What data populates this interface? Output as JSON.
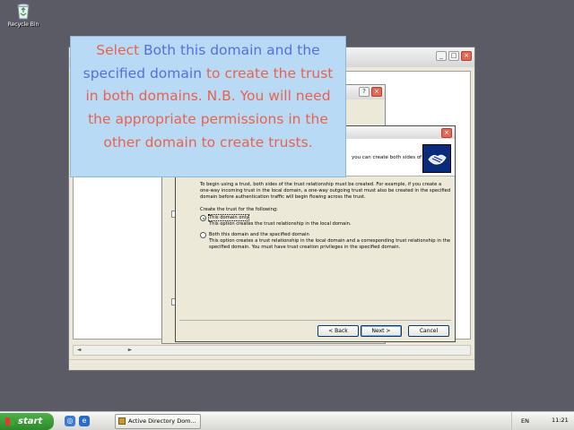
{
  "desktop": {
    "recycle_bin_label": "Recycle Bin"
  },
  "callout": {
    "part1": "Select ",
    "highlight1": "Both this domain and the specified domain",
    "part2": " to create the trust in both domains. N.B. You will need the appropriate permissions in the other domain to create trusts."
  },
  "wizard": {
    "header_text": "you can create both sides of",
    "intro": "To begin using a trust, both sides of the trust relationship must be created. For example, if you create a one-way incoming trust in the local domain, a one-way outgoing trust must also be created in the specified domain before authentication traffic will begin flowing across the trust.",
    "create_for_label": "Create the trust for the following:",
    "options": [
      {
        "label": "This domain only",
        "description": "This option creates the trust relationship in the local domain.",
        "selected": true
      },
      {
        "label": "Both this domain and the specified domain",
        "description": "This option creates a trust relationship in the local domain and a corresponding trust relationship in the specified domain. You must have trust creation privileges in the specified domain.",
        "selected": false
      }
    ],
    "back_button": "< Back",
    "next_button": "Next >",
    "cancel_button": "Cancel"
  },
  "taskbar": {
    "start_label": "start",
    "task_label": "Active Directory Dom...",
    "language": "EN",
    "clock": "11:21"
  },
  "colors": {
    "callout_bg": "#b8daf5",
    "callout_text": "#e8634f",
    "callout_highlight": "#5a6de0",
    "start_green": "#3a9a36"
  }
}
